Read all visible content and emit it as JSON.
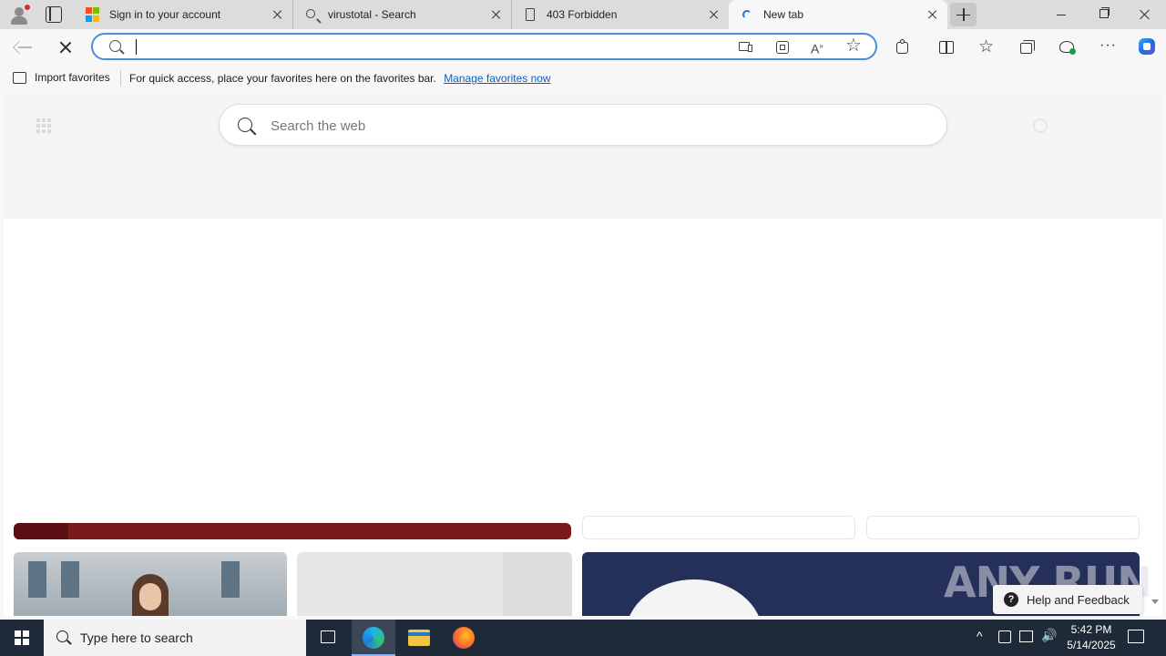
{
  "tabs": [
    {
      "title": "Sign in to your account",
      "favicon": "microsoft-logo-icon"
    },
    {
      "title": "virustotal - Search",
      "favicon": "search-icon"
    },
    {
      "title": "403 Forbidden",
      "favicon": "page-icon"
    },
    {
      "title": "New tab",
      "favicon": "loading-icon",
      "active": true
    }
  ],
  "address_bar": {
    "value": "",
    "placeholder": ""
  },
  "favorites_bar": {
    "import_label": "Import favorites",
    "message": "For quick access, place your favorites here on the favorites bar.",
    "link": "Manage favorites now"
  },
  "page": {
    "search_placeholder": "Search the web"
  },
  "help": {
    "label": "Help and Feedback"
  },
  "watermark": "ANY RUN",
  "taskbar": {
    "search_placeholder": "Type here to search",
    "time": "5:42 PM",
    "date": "5/14/2025"
  },
  "colors": {
    "accent": "#4a8ed8",
    "link": "#0f5ebd",
    "taskbar": "#1f2a38"
  }
}
